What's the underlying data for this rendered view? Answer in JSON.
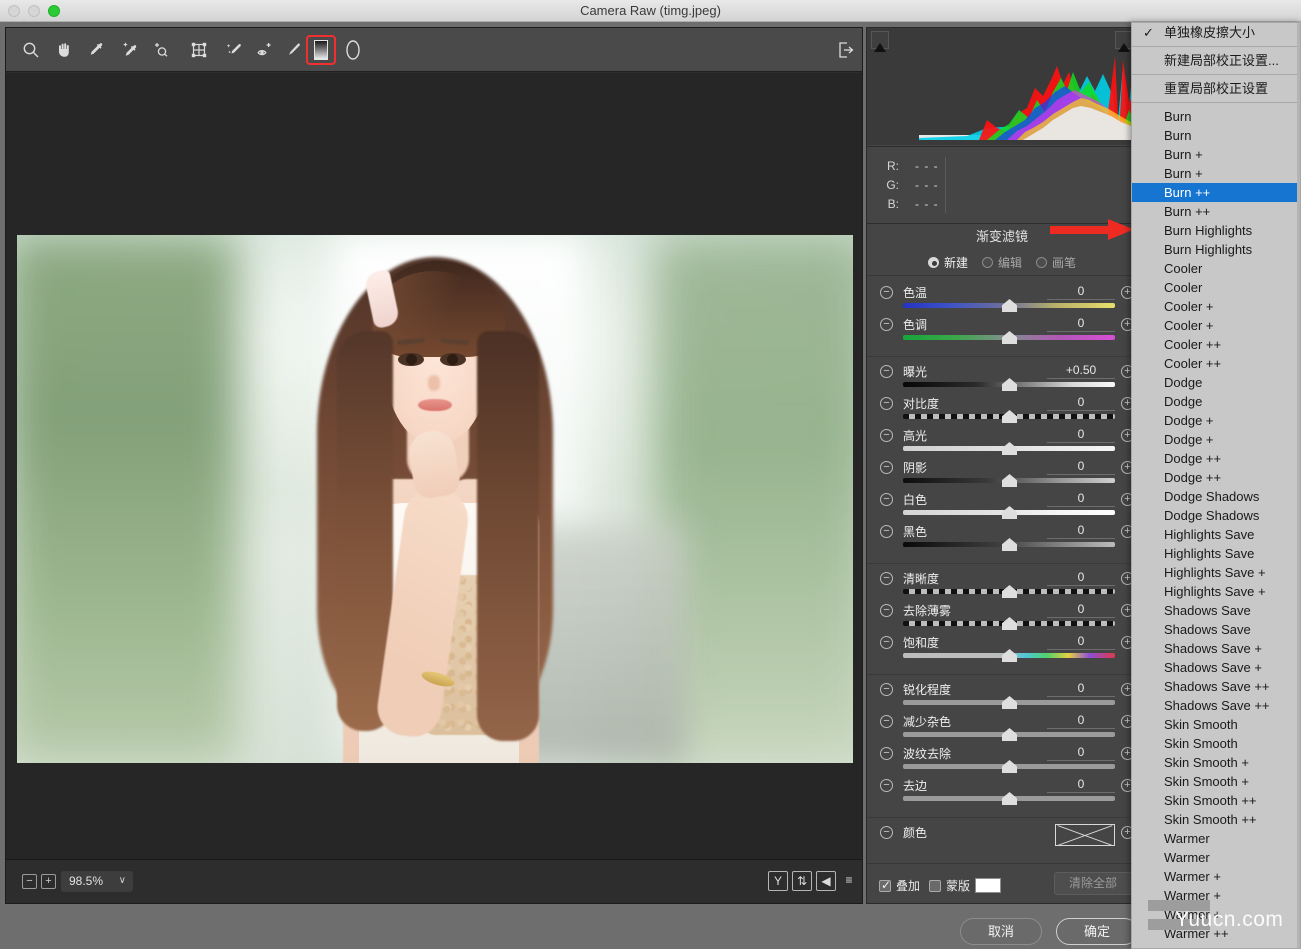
{
  "window": {
    "title": "Camera Raw (timg.jpeg)",
    "traffic_lights": [
      "close-button",
      "minimize-button",
      "zoom-button"
    ]
  },
  "toolbar": {
    "tools": [
      {
        "name": "zoom-tool",
        "icon": "magnifier-icon",
        "selected": false
      },
      {
        "name": "hand-tool",
        "icon": "hand-icon",
        "selected": false
      },
      {
        "name": "white-balance-tool",
        "icon": "eyedropper-icon",
        "selected": false
      },
      {
        "name": "color-sampler-tool",
        "icon": "color-sampler-icon",
        "selected": false
      },
      {
        "name": "targeted-adjustment-tool",
        "icon": "targeted-adjustment-icon",
        "selected": false
      },
      {
        "name": "crop-tool",
        "icon": "crop-icon",
        "selected": false
      },
      {
        "name": "spot-removal-tool",
        "icon": "spot-removal-icon",
        "selected": false
      },
      {
        "name": "red-eye-tool",
        "icon": "red-eye-icon",
        "selected": false
      },
      {
        "name": "adjustment-brush-tool",
        "icon": "brush-icon",
        "selected": false
      },
      {
        "name": "graduated-filter-tool",
        "icon": "graduated-filter-icon",
        "selected": true
      },
      {
        "name": "radial-filter-tool",
        "icon": "radial-filter-icon",
        "selected": false
      }
    ],
    "preferences_icon": "preferences-export-icon"
  },
  "footer": {
    "zoom_out_label": "−",
    "zoom_in_label": "+",
    "zoom_value": "98.5%",
    "zoom_caret": "∨",
    "right_buttons": [
      {
        "name": "yellow-channel-button",
        "label": "Y"
      },
      {
        "name": "before-after-swap-button",
        "label": "⇅"
      },
      {
        "name": "before-after-toggle-button",
        "label": "◀"
      },
      {
        "name": "preview-settings-button",
        "label": "≡"
      }
    ]
  },
  "histogram": {
    "clip_shadow_icon": "shadow-clipping-icon",
    "clip_highlight_icon": "highlight-clipping-icon"
  },
  "readout": {
    "rows": [
      {
        "key": "R:",
        "value": "- - -"
      },
      {
        "key": "G:",
        "value": "- - -"
      },
      {
        "key": "B:",
        "value": "- - -"
      }
    ]
  },
  "panel": {
    "title": "渐变滤镜",
    "modes": [
      {
        "label": "新建",
        "active": true
      },
      {
        "label": "编辑",
        "active": false
      },
      {
        "label": "画笔",
        "active": false
      }
    ],
    "slider_groups": [
      {
        "sliders": [
          {
            "label": "色温",
            "value": "0",
            "pos": 50,
            "track": "temperature"
          },
          {
            "label": "色调",
            "value": "0",
            "pos": 50,
            "track": "tint"
          }
        ]
      },
      {
        "sliders": [
          {
            "label": "曝光",
            "value": "+0.50",
            "pos": 50,
            "track": "exposure"
          },
          {
            "label": "对比度",
            "value": "0",
            "pos": 50,
            "track": "contrast"
          },
          {
            "label": "高光",
            "value": "0",
            "pos": 50,
            "track": "plain-light"
          },
          {
            "label": "阴影",
            "value": "0",
            "pos": 50,
            "track": "shadows"
          },
          {
            "label": "白色",
            "value": "0",
            "pos": 50,
            "track": "whites"
          },
          {
            "label": "黑色",
            "value": "0",
            "pos": 50,
            "track": "blacks"
          }
        ]
      },
      {
        "sliders": [
          {
            "label": "清晰度",
            "value": "0",
            "pos": 50,
            "track": "contrast"
          },
          {
            "label": "去除薄雾",
            "value": "0",
            "pos": 50,
            "track": "contrast"
          },
          {
            "label": "饱和度",
            "value": "0",
            "pos": 50,
            "track": "saturation"
          }
        ]
      },
      {
        "sliders": [
          {
            "label": "锐化程度",
            "value": "0",
            "pos": 50,
            "track": "plain"
          },
          {
            "label": "减少杂色",
            "value": "0",
            "pos": 50,
            "track": "plain"
          },
          {
            "label": "波纹去除",
            "value": "0",
            "pos": 50,
            "track": "plain"
          },
          {
            "label": "去边",
            "value": "0",
            "pos": 50,
            "track": "plain"
          }
        ]
      },
      {
        "sliders": [
          {
            "label": "颜色",
            "value": "",
            "pos": -1,
            "track": "color-swatch"
          }
        ]
      }
    ],
    "footer": {
      "overlay_label": "叠加",
      "overlay_checked": true,
      "mask_label": "蒙版",
      "mask_checked": false,
      "clear_all_label": "清除全部"
    }
  },
  "dialog": {
    "cancel_label": "取消",
    "ok_label": "确定"
  },
  "menu": {
    "items": [
      {
        "label": "单独橡皮擦大小",
        "checked": true
      },
      {
        "sep": true
      },
      {
        "label": "新建局部校正设置..."
      },
      {
        "sep": true
      },
      {
        "label": "重置局部校正设置"
      },
      {
        "sep": true
      },
      {
        "label": "Burn"
      },
      {
        "label": "Burn"
      },
      {
        "label": "Burn +"
      },
      {
        "label": "Burn +"
      },
      {
        "label": "Burn ++",
        "highlighted": true
      },
      {
        "label": "Burn ++"
      },
      {
        "label": "Burn Highlights"
      },
      {
        "label": "Burn Highlights"
      },
      {
        "label": "Cooler"
      },
      {
        "label": "Cooler"
      },
      {
        "label": "Cooler +"
      },
      {
        "label": "Cooler +"
      },
      {
        "label": "Cooler ++"
      },
      {
        "label": "Cooler ++"
      },
      {
        "label": "Dodge"
      },
      {
        "label": "Dodge"
      },
      {
        "label": "Dodge +"
      },
      {
        "label": "Dodge +"
      },
      {
        "label": "Dodge ++"
      },
      {
        "label": "Dodge ++"
      },
      {
        "label": "Dodge Shadows"
      },
      {
        "label": "Dodge Shadows"
      },
      {
        "label": "Highlights Save"
      },
      {
        "label": "Highlights Save"
      },
      {
        "label": "Highlights Save +"
      },
      {
        "label": "Highlights Save +"
      },
      {
        "label": "Shadows Save"
      },
      {
        "label": "Shadows Save"
      },
      {
        "label": "Shadows Save +"
      },
      {
        "label": "Shadows Save +"
      },
      {
        "label": "Shadows Save ++"
      },
      {
        "label": "Shadows Save ++"
      },
      {
        "label": "Skin Smooth"
      },
      {
        "label": "Skin Smooth"
      },
      {
        "label": "Skin Smooth +"
      },
      {
        "label": "Skin Smooth +"
      },
      {
        "label": "Skin Smooth ++"
      },
      {
        "label": "Skin Smooth ++"
      },
      {
        "label": "Warmer"
      },
      {
        "label": "Warmer"
      },
      {
        "label": "Warmer +"
      },
      {
        "label": "Warmer +"
      },
      {
        "label": "Warmer +"
      },
      {
        "label": "Warmer ++"
      }
    ]
  },
  "watermark": {
    "text": "Yuucn.com"
  },
  "colors": {
    "highlight": "#1675d1",
    "selected_tool_outline": "#f03030",
    "arrow": "#ee2b23",
    "panel_bg": "#454545",
    "menu_bg": "#c8c8c8"
  }
}
